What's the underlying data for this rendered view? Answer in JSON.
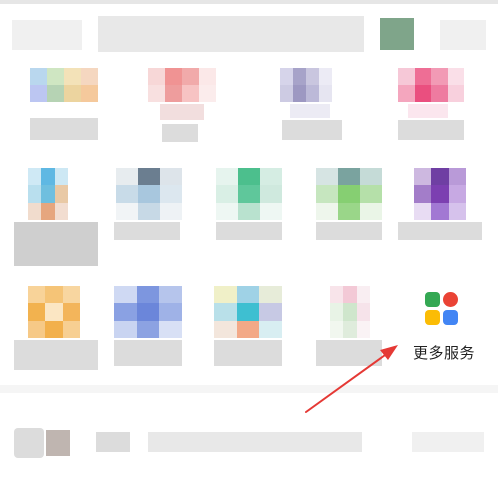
{
  "screen": {
    "more_services_label": "更多服务"
  },
  "icons": {
    "more_services": "more-services-grid-icon",
    "annotation": "red-arrow"
  },
  "colors": {
    "more_icon": [
      "#34a853",
      "#ea4335",
      "#fbbc05",
      "#4285f4"
    ],
    "arrow": "#e53935"
  }
}
